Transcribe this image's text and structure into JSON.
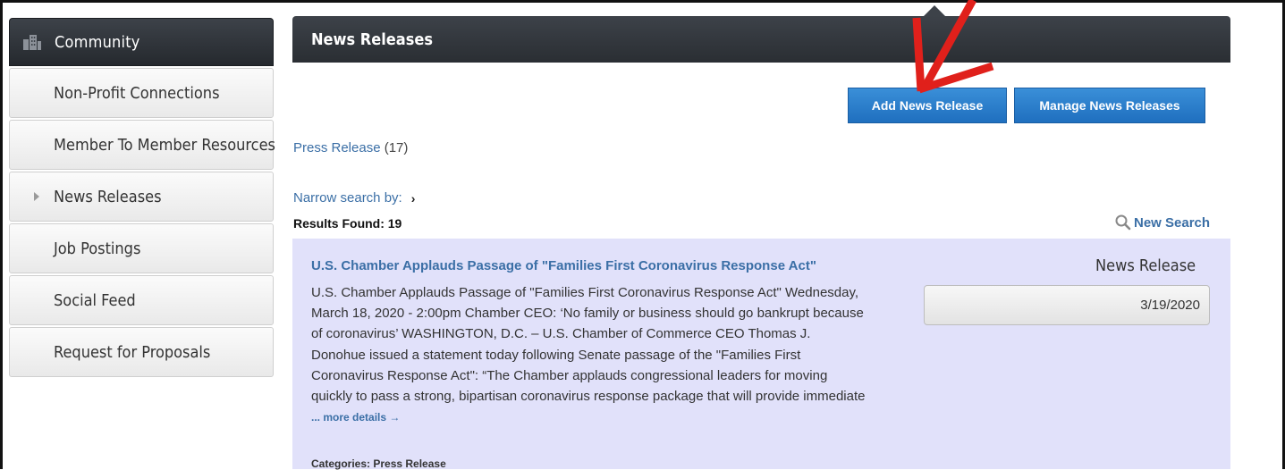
{
  "sidebar": {
    "header": "Community",
    "items": [
      {
        "label": "Non-Profit Connections",
        "active": false
      },
      {
        "label": "Member To Member Resources",
        "active": false
      },
      {
        "label": "News Releases",
        "active": true
      },
      {
        "label": "Job Postings",
        "active": false
      },
      {
        "label": "Social Feed",
        "active": false
      },
      {
        "label": "Request for Proposals",
        "active": false
      }
    ]
  },
  "main": {
    "title": "News Releases",
    "add_button": "Add News Release",
    "manage_button": "Manage News Releases",
    "category_link": "Press Release",
    "category_count": "(17)",
    "narrow_label": "Narrow search by:",
    "results_found": "Results Found: 19",
    "new_search": "New Search"
  },
  "results": [
    {
      "title": "U.S. Chamber Applauds Passage of \"Families First Coronavirus Response Act\"",
      "body": "U.S. Chamber Applauds Passage of \"Families First Coronavirus Response Act\"  Wednesday, March 18, 2020 - 2:00pm Chamber CEO: ‘No family or business should go bankrupt because of coronavirus’ WASHINGTON, D.C. – U.S. Chamber of Commerce CEO Thomas J. Donohue issued a statement today following Senate passage of the \"Families First Coronavirus Response Act\": “The Chamber applauds congressional leaders for moving quickly to pass a strong, bipartisan coronavirus response package that will provide immediate",
      "more": "... more details →",
      "categories": "Categories: Press Release",
      "type": "News Release",
      "date": "3/19/2020"
    }
  ],
  "colors": {
    "header_bg": "#2f3338",
    "button_blue": "#2a7dcc",
    "link_blue": "#3b6fa6",
    "card_bg": "#e1e1fa",
    "annotation_arrow": "#e0201b"
  }
}
